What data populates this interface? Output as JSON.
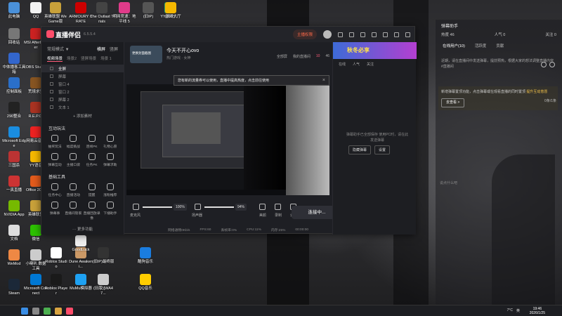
{
  "desktop_icons": [
    {
      "label": "此电脑",
      "color": "#4a90d9"
    },
    {
      "label": "QQ",
      "color": "#f2f2f2"
    },
    {
      "label": "英雄联盟 WeGame版",
      "color": "#c9a13a"
    },
    {
      "label": "ARMOURY CRATE",
      "color": "#c00"
    },
    {
      "label": "The Outlast Trials",
      "color": "#444"
    },
    {
      "label": "明网竞速：地平线 5",
      "color": "#e03b8a"
    },
    {
      "label": "(旧IP)",
      "color": "#555"
    },
    {
      "label": "(旧IP)",
      "color": "#3a6"
    },
    {
      "label": "YY游戏大厅",
      "color": "#f5b800"
    },
    {
      "label": "回收站",
      "color": "#777"
    },
    {
      "label": "MSI Afterburner",
      "color": "#c22"
    },
    {
      "label": "中体播客工具箱",
      "color": "#3366cc"
    },
    {
      "label": "OBS Studio",
      "color": "#333"
    },
    {
      "label": "控制面板",
      "color": "#2a6fc9"
    },
    {
      "label": "荒境求生",
      "color": "#885522"
    },
    {
      "label": "290整合",
      "color": "#222"
    },
    {
      "label": "R.E.P.O.",
      "color": "#aa3322"
    },
    {
      "label": "Microsoft Edge",
      "color": "#1a8de0"
    },
    {
      "label": "网易云音乐",
      "color": "#e22"
    },
    {
      "label": "三国杀",
      "color": "#b33"
    },
    {
      "label": "YY语音",
      "color": "#f5b800"
    },
    {
      "label": "一真直播",
      "color": "#c33"
    },
    {
      "label": "Office 2019",
      "color": "#e35b1c"
    },
    {
      "label": "NVIDIA App",
      "color": "#76b900"
    },
    {
      "label": "英雄联盟",
      "color": "#c9a13a"
    },
    {
      "label": "文档",
      "color": "#ddd"
    },
    {
      "label": "微信",
      "color": "#2dc100"
    },
    {
      "label": "WeMod",
      "color": "#e84"
    },
    {
      "label": "Steam",
      "color": "#1b2838"
    },
    {
      "label": "小喇叭 数据工具",
      "color": "#ccc"
    },
    {
      "label": "Roblox Studio",
      "color": "#fff"
    },
    {
      "label": "Dune Awakeni...",
      "color": "#c96"
    },
    {
      "label": "(旧IP)最终版",
      "color": "#333"
    },
    {
      "label": "酷狗音乐",
      "color": "#1a7de0"
    },
    {
      "label": "Microsoft Connect",
      "color": "#0078d4"
    },
    {
      "label": "Roblox Player",
      "color": "#1a1a1a"
    },
    {
      "label": "MuMu模拟器",
      "color": "#1ea1f2"
    },
    {
      "label": "(旧版)[WA47...",
      "color": "#ccc"
    },
    {
      "label": "QQ音乐",
      "color": "#ffcd00"
    },
    {
      "label": "GoodLuck",
      "color": "#eee"
    }
  ],
  "app": {
    "name": "直播伴侣",
    "version": "6.5.5.4",
    "header_pill": "主播权限",
    "left": {
      "mode": "常规模式 ▼",
      "mode_tabs": [
        "横屏",
        "竖屏"
      ],
      "scene_tabs": [
        "视频场景",
        "场景2",
        "竖屏场景",
        "场景 1"
      ],
      "sources": [
        "全屏",
        "屏幕",
        "窗口 4",
        "窗口 2",
        "屏幕 2",
        "文本 1"
      ],
      "add_source": "+ 添加素材",
      "interactive_title": "互动玩法",
      "interactive": [
        "抽奖玩法",
        "幅度挑战",
        "连线PK",
        "礼物心愿",
        "弹幕互动",
        "主播口袋",
        "任务PK",
        "弹幕求助"
      ],
      "basic_title": "基础工具",
      "basic": [
        "任务中心",
        "直播活动",
        "提醒",
        "涨粉推荐",
        "弹幕事",
        "直播间管家",
        "直播回放录像",
        "下播助手"
      ],
      "more": "··· 更多功能"
    },
    "center": {
      "cover_label": "更换封面截图",
      "live_title": "今天不开心ovo",
      "category": "热门游戏 · 女神",
      "header_actions": [
        "全部屏",
        "我的直播间",
        "10",
        "46"
      ],
      "notice_text": "您有新的流量券可以使用，直播中提高热度，点击前往使用",
      "notice_highlight": "流量券",
      "mic_label": "麦克风",
      "mic_volume": "100%",
      "speaker_label": "扬声器",
      "speaker_volume": "94%",
      "beauty_label": "美颜",
      "record_label": "录制",
      "settings_label": "设置",
      "go_live": "连接中...",
      "status_items": [
        "网络通畅0Kb/s",
        "FPS:60",
        "丢帧率:0%",
        "CPU:11%",
        "内存:25%",
        "00:00:00"
      ]
    },
    "right": {
      "banner": "秋冬必享",
      "stats": [
        "在线",
        "人气",
        "关注"
      ],
      "empty_hint": "弹幕助手已全部保存 使用PC时，请在此发送弹幕",
      "buttons": [
        "隐藏弹幕",
        "设置"
      ]
    }
  },
  "danmu": {
    "title": "弹幕助手",
    "stats": [
      {
        "label": "热度",
        "value": "46"
      },
      {
        "label": "人气",
        "value": "0"
      },
      {
        "label": "关注",
        "value": "0"
      }
    ],
    "tabs": [
      "在线用户(10)",
      "活跃度",
      "贡献"
    ],
    "notice": "近期，请在直播间中发送弹幕，提前预热，根据大家的想法调整直播内容 #直播间",
    "box_pre": "新增弹幕置顶功能，点击弹幕或在观看直播的同时置顶",
    "box_hl": "提升互动意愿",
    "box_btn": "去查看 >",
    "input_hint": "说点什么吧",
    "counter": "0条/1条"
  },
  "taskbar": {
    "time": "19:46",
    "date": "2026/1/25",
    "lang": "英",
    "temp": "7°C"
  }
}
